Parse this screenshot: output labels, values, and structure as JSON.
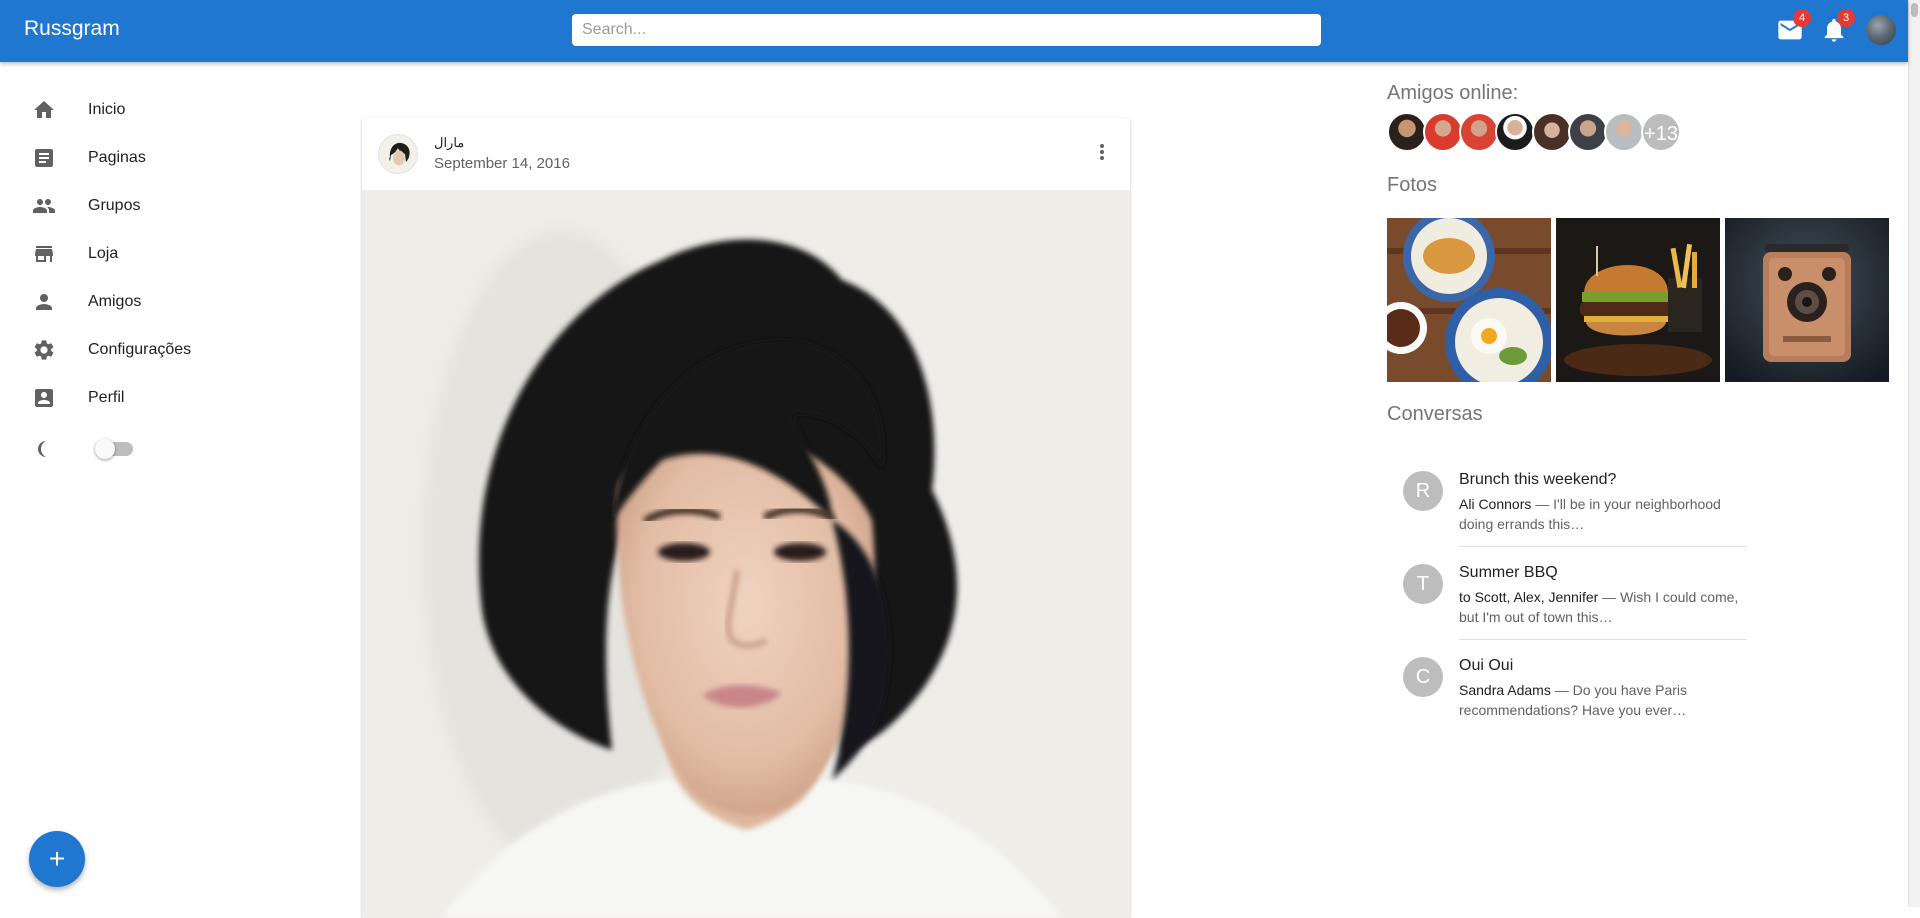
{
  "appbar": {
    "brand": "Russgram",
    "search_placeholder": "Search...",
    "mail_count": "4",
    "notifications_count": "3"
  },
  "sidebar": {
    "items": [
      {
        "label": "Inicio",
        "icon": "home-icon"
      },
      {
        "label": "Paginas",
        "icon": "article-icon"
      },
      {
        "label": "Grupos",
        "icon": "group-icon"
      },
      {
        "label": "Loja",
        "icon": "store-icon"
      },
      {
        "label": "Amigos",
        "icon": "person-icon"
      },
      {
        "label": "Configurações",
        "icon": "gear-icon"
      },
      {
        "label": "Perfil",
        "icon": "profile-card-icon"
      }
    ],
    "dark_mode_on": false
  },
  "post": {
    "author": "مارال",
    "date": "September 14, 2016"
  },
  "right": {
    "friends_title": "Amigos online:",
    "friends_more": "+13",
    "photos_title": "Fotos",
    "conversations_title": "Conversas",
    "conversations": [
      {
        "initial": "R",
        "title": "Brunch this weekend?",
        "who": "Ali Connors",
        "snippet": " — I'll be in your neighborhood doing errands this…"
      },
      {
        "initial": "T",
        "title": "Summer BBQ",
        "who": "to Scott, Alex, Jennifer",
        "snippet": " — Wish I could come, but I'm out of town this…"
      },
      {
        "initial": "C",
        "title": "Oui Oui",
        "who": "Sandra Adams",
        "snippet": " — Do you have Paris recommendations? Have you ever…"
      }
    ]
  },
  "colors": {
    "primary": "#1f77d0",
    "badge": "#e53935"
  }
}
